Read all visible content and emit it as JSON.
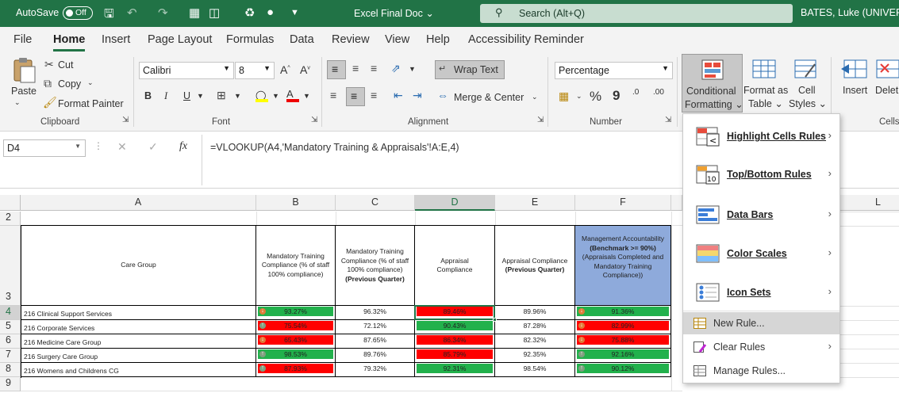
{
  "titlebar": {
    "autosave": "AutoSave",
    "toggle": "Off",
    "doc_title": "Excel Final Doc",
    "search_placeholder": "Search (Alt+Q)",
    "user": "BATES, Luke (UNIVERSIT"
  },
  "menu": [
    "File",
    "Home",
    "Insert",
    "Page Layout",
    "Formulas",
    "Data",
    "Review",
    "View",
    "Help",
    "Accessibility Reminder"
  ],
  "ribbon": {
    "clipboard": {
      "paste": "Paste",
      "cut": "Cut",
      "copy": "Copy",
      "format_painter": "Format Painter",
      "label": "Clipboard"
    },
    "font": {
      "name": "Calibri",
      "size": "8",
      "label": "Font",
      "bold": "B",
      "italic": "I",
      "underline": "U"
    },
    "alignment": {
      "wrap": "Wrap Text",
      "merge": "Merge & Center",
      "label": "Alignment"
    },
    "number": {
      "format": "Percentage",
      "label": "Number",
      "percent": "%",
      "comma": "9",
      "inc": ".00",
      "dec": ".0"
    },
    "styles": {
      "conditional": [
        "Conditional",
        "Formatting"
      ],
      "format_table": [
        "Format as",
        "Table"
      ],
      "cell_styles": [
        "Cell",
        "Styles"
      ]
    },
    "cells": {
      "insert": "Insert",
      "delete": "Delet",
      "label": "Cells"
    }
  },
  "formula": {
    "namebox": "D4",
    "fx": "fx",
    "content": "=VLOOKUP(A4,'Mandatory Training & Appraisals'!A:E,4)"
  },
  "sheet": {
    "columns": [
      "A",
      "B",
      "C",
      "D",
      "E",
      "F",
      "L"
    ],
    "rows": [
      "2",
      "3",
      "4",
      "5",
      "6",
      "7",
      "8",
      "9"
    ],
    "headers": {
      "A": "Care Group",
      "B": "Mandatory Training Compliance (% of staff 100% compliance)",
      "C1": "Mandatory Training Compliance (% of staff 100% compliance)",
      "C2": "(Previous Quarter)",
      "D": "Appraisal Compliance",
      "E1": "Appraisal Compliance",
      "E2": "(Previous Quarter)",
      "F1": "Management Accountability ",
      "F2": "(Benchmark >= 90%)",
      "F3": " (Appraisals Completed and Mandatory Training Compliance))"
    },
    "data": [
      {
        "name": "216 Clinical Support Services",
        "b": "93.27%",
        "b_bg": "#22b14c",
        "b_arrow": "down",
        "c": "96.32%",
        "d": "89.46%",
        "d_bg": "#ff0000",
        "e": "89.96%",
        "f": "91.36%",
        "f_bg": "#22b14c",
        "f_arrow": "down"
      },
      {
        "name": "216 Corporate Services",
        "b": "75.54%",
        "b_bg": "#ff0000",
        "b_arrow": "up",
        "c": "72.12%",
        "d": "90.43%",
        "d_bg": "#22b14c",
        "e": "87.28%",
        "f": "82.99%",
        "f_bg": "#ff0000",
        "f_arrow": "down"
      },
      {
        "name": "216 Medicine Care Group",
        "b": "65.43%",
        "b_bg": "#ff0000",
        "b_arrow": "down",
        "c": "87.65%",
        "d": "86.34%",
        "d_bg": "#ff0000",
        "e": "82.32%",
        "f": "75.88%",
        "f_bg": "#ff0000",
        "f_arrow": "down"
      },
      {
        "name": "216 Surgery Care Group",
        "b": "98.53%",
        "b_bg": "#22b14c",
        "b_arrow": "up",
        "c": "89.76%",
        "d": "85.79%",
        "d_bg": "#ff0000",
        "e": "92.35%",
        "f": "92.16%",
        "f_bg": "#22b14c",
        "f_arrow": "up"
      },
      {
        "name": "216 Womens and Childrens CG",
        "b": "87.93%",
        "b_bg": "#ff0000",
        "b_arrow": "up",
        "c": "79.32%",
        "d": "92.31%",
        "d_bg": "#22b14c",
        "e": "98.54%",
        "f": "90.12%",
        "f_bg": "#22b14c",
        "f_arrow": "up"
      }
    ]
  },
  "dropdown": {
    "items": [
      "Highlight Cells Rules",
      "Top/Bottom Rules",
      "Data Bars",
      "Color Scales",
      "Icon Sets"
    ],
    "actions": [
      "New Rule...",
      "Clear Rules",
      "Manage Rules..."
    ]
  },
  "colors": {
    "excel_green": "#217346",
    "header_fill": "#8eaadb",
    "green": "#22b14c",
    "red": "#ff0000"
  }
}
